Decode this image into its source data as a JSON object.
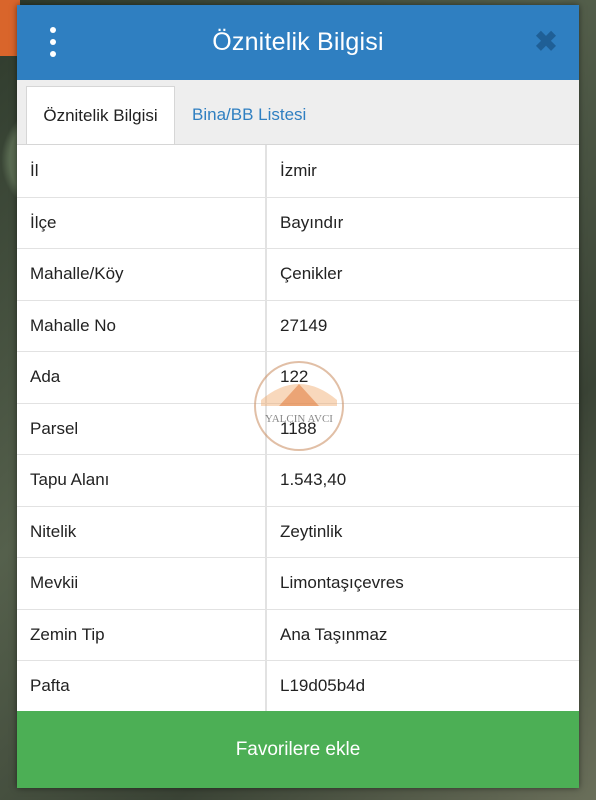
{
  "header": {
    "title": "Öznitelik Bilgisi",
    "menu_icon": "more-vertical-icon",
    "close_icon": "close-icon",
    "color": "#2f7fc1"
  },
  "tabs": [
    {
      "label": "Öznitelik Bilgisi",
      "active": true
    },
    {
      "label": "Bina/BB Listesi",
      "active": false
    }
  ],
  "rows": [
    {
      "key": "İl",
      "value": "İzmir"
    },
    {
      "key": "İlçe",
      "value": "Bayındır"
    },
    {
      "key": "Mahalle/Köy",
      "value": "Çenikler"
    },
    {
      "key": "Mahalle No",
      "value": "27149"
    },
    {
      "key": "Ada",
      "value": "122"
    },
    {
      "key": "Parsel",
      "value": "1188"
    },
    {
      "key": "Tapu Alanı",
      "value": "1.543,40"
    },
    {
      "key": "Nitelik",
      "value": "Zeytinlik"
    },
    {
      "key": "Mevkii",
      "value": "Limontaşıçevres"
    },
    {
      "key": "Zemin Tip",
      "value": "Ana Taşınmaz"
    },
    {
      "key": "Pafta",
      "value": "L19d05b4d"
    }
  ],
  "watermark": {
    "text": "YALÇIN AVCI"
  },
  "footer": {
    "button_label": "Favorilere ekle",
    "color": "#4caf55"
  }
}
